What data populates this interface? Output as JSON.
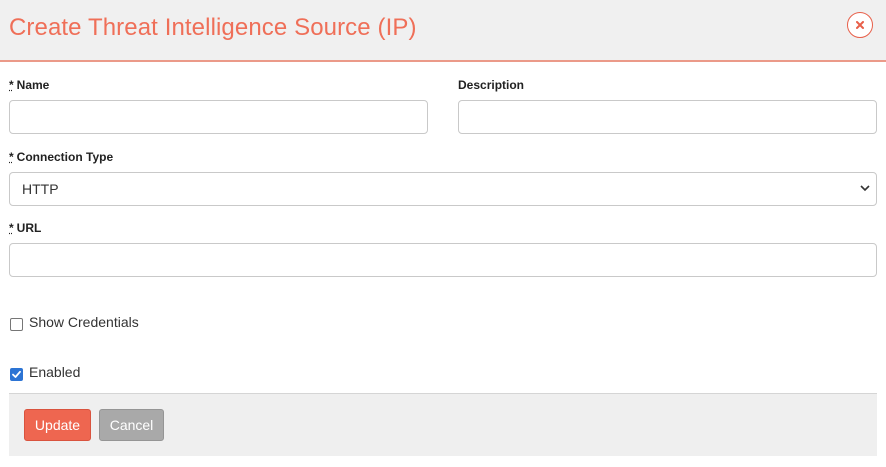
{
  "dialog": {
    "title": "Create Threat Intelligence Source (IP)",
    "accent_color": "#ef6f58"
  },
  "form": {
    "required_marker": "*",
    "name": {
      "label": "Name",
      "value": ""
    },
    "description": {
      "label": "Description",
      "value": ""
    },
    "connection_type": {
      "label": "Connection Type",
      "value": "HTTP"
    },
    "url": {
      "label": "URL",
      "value": ""
    },
    "show_credentials": {
      "label": "Show Credentials",
      "checked": false
    },
    "enabled": {
      "label": "Enabled",
      "checked": true
    }
  },
  "footer": {
    "update_label": "Update",
    "cancel_label": "Cancel",
    "update_color": "#ee6650",
    "cancel_color": "#a9a9a9"
  }
}
